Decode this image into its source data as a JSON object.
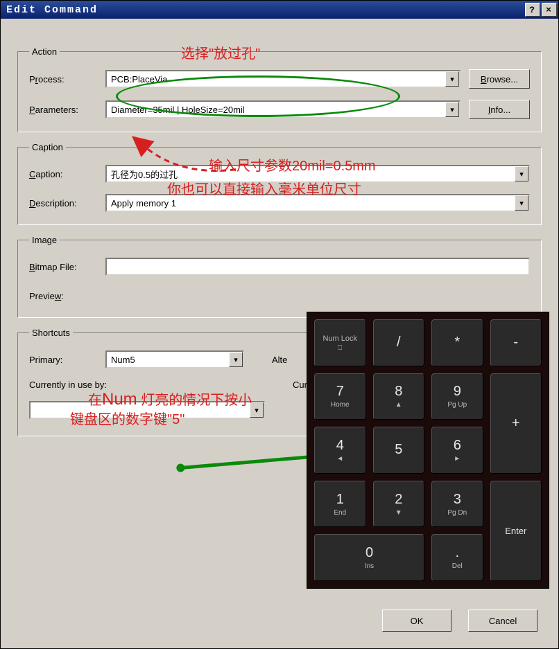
{
  "window": {
    "title": "Edit Command",
    "help_btn": "?",
    "close_btn": "×"
  },
  "groups": {
    "action": {
      "legend": "Action",
      "process_label": "Process:",
      "process_value": "PCB:PlaceVia",
      "browse_btn": "Browse...",
      "parameters_label": "Parameters:",
      "parameters_value": "Diameter=35mil | HoleSize=20mil",
      "info_btn": "Info..."
    },
    "caption": {
      "legend": "Caption",
      "caption_label": "Caption:",
      "caption_value": "孔径为0.5的过孔",
      "description_label": "Description:",
      "description_value": "Apply memory 1"
    },
    "image": {
      "legend": "Image",
      "bitmap_label": "Bitmap File:",
      "bitmap_value": "",
      "preview_label": "Preview:"
    },
    "shortcuts": {
      "legend": "Shortcuts",
      "primary_label": "Primary:",
      "primary_value": "Num5",
      "alternate_label": "Alte",
      "inuse_label": "Currently in use by:",
      "inuse_alt_label": "Cur"
    }
  },
  "buttons": {
    "ok": "OK",
    "cancel": "Cancel"
  },
  "annotations": {
    "a1": "选择\"放过孔\"",
    "a2": "输入尺寸参数20mil=0.5mm",
    "a3": "你也可以直接输入毫米单位尺寸",
    "a4_prefix": "在",
    "a4_num": "Num",
    "a4_rest": " 灯亮的情况下按小",
    "a5": "键盘区的数字键\"5\""
  },
  "keypad": {
    "numlock": "Num Lock",
    "slash": "/",
    "star": "*",
    "minus": "-",
    "k7": "7",
    "k7s": "Home",
    "k8": "8",
    "k8s": "▲",
    "k9": "9",
    "k9s": "Pg Up",
    "plus": "+",
    "k4": "4",
    "k4s": "◄",
    "k5": "5",
    "k6": "6",
    "k6s": "►",
    "k1": "1",
    "k1s": "End",
    "k2": "2",
    "k2s": "▼",
    "k3": "3",
    "k3s": "Pg Dn",
    "enter": "Enter",
    "k0": "0",
    "k0s": "Ins",
    "kdot": ".",
    "kdots": "Del"
  }
}
